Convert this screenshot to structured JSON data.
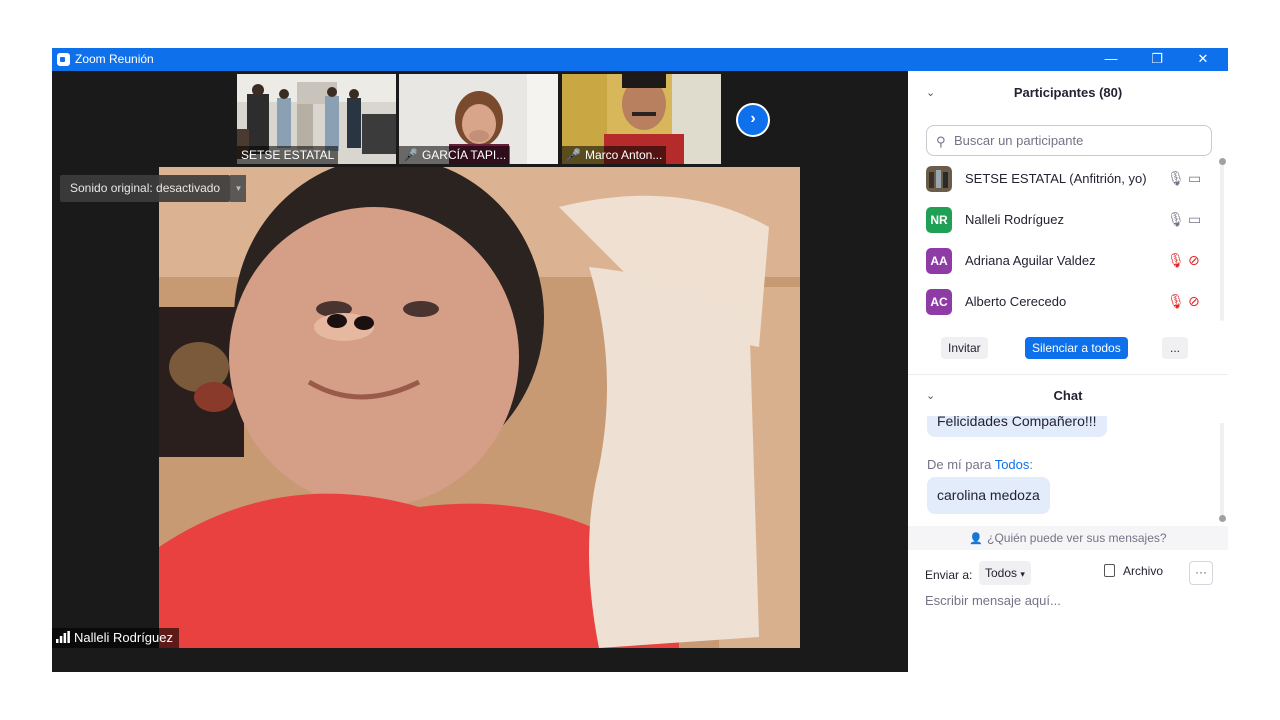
{
  "window": {
    "title": "Zoom Reunión",
    "controls": [
      "—",
      "❐",
      "✕"
    ]
  },
  "thumbnails": [
    {
      "name": "SETSE ESTATAL",
      "muted": false
    },
    {
      "name": "GARCÍA TAPI...",
      "muted": true
    },
    {
      "name": "Marco Anton...",
      "muted": true
    }
  ],
  "next_icon": "›",
  "sound": {
    "label": "Sonido original: desactivado",
    "dropdown": "▼"
  },
  "speaker": {
    "name": "Nalleli Rodríguez"
  },
  "participants": {
    "header": "Participantes (80)",
    "search_placeholder": "Buscar un participante",
    "list": [
      {
        "initials": "",
        "name": "SETSE ESTATAL (Anfitrión, yo)",
        "color": "#6b5d4a",
        "muted": false
      },
      {
        "initials": "NR",
        "name": "Nalleli Rodríguez",
        "color": "#1fa055",
        "muted": false
      },
      {
        "initials": "AA",
        "name": "Adriana Aguilar Valdez",
        "color": "#8e3ba6",
        "muted": true
      },
      {
        "initials": "AC",
        "name": "Alberto Cerecedo",
        "color": "#8e3ba6",
        "muted": true
      }
    ],
    "buttons": {
      "invite": "Invitar",
      "mute_all": "Silenciar a todos",
      "more": "..."
    }
  },
  "chat": {
    "header": "Chat",
    "prev_message": "Felicidades Compañero!!!",
    "from_prefix": "De mí para ",
    "from_to": "Todos",
    "from_suffix": ":",
    "message": "carolina medoza",
    "who_can_see": "¿Quién puede ver sus mensajes?",
    "send_to_label": "Enviar a:",
    "send_to_value": "Todos",
    "file_label": "Archivo",
    "more": "···",
    "input_placeholder": "Escribir mensaje aquí..."
  },
  "colors": {
    "accent": "#0e71eb",
    "muted_red": "#e02828"
  }
}
